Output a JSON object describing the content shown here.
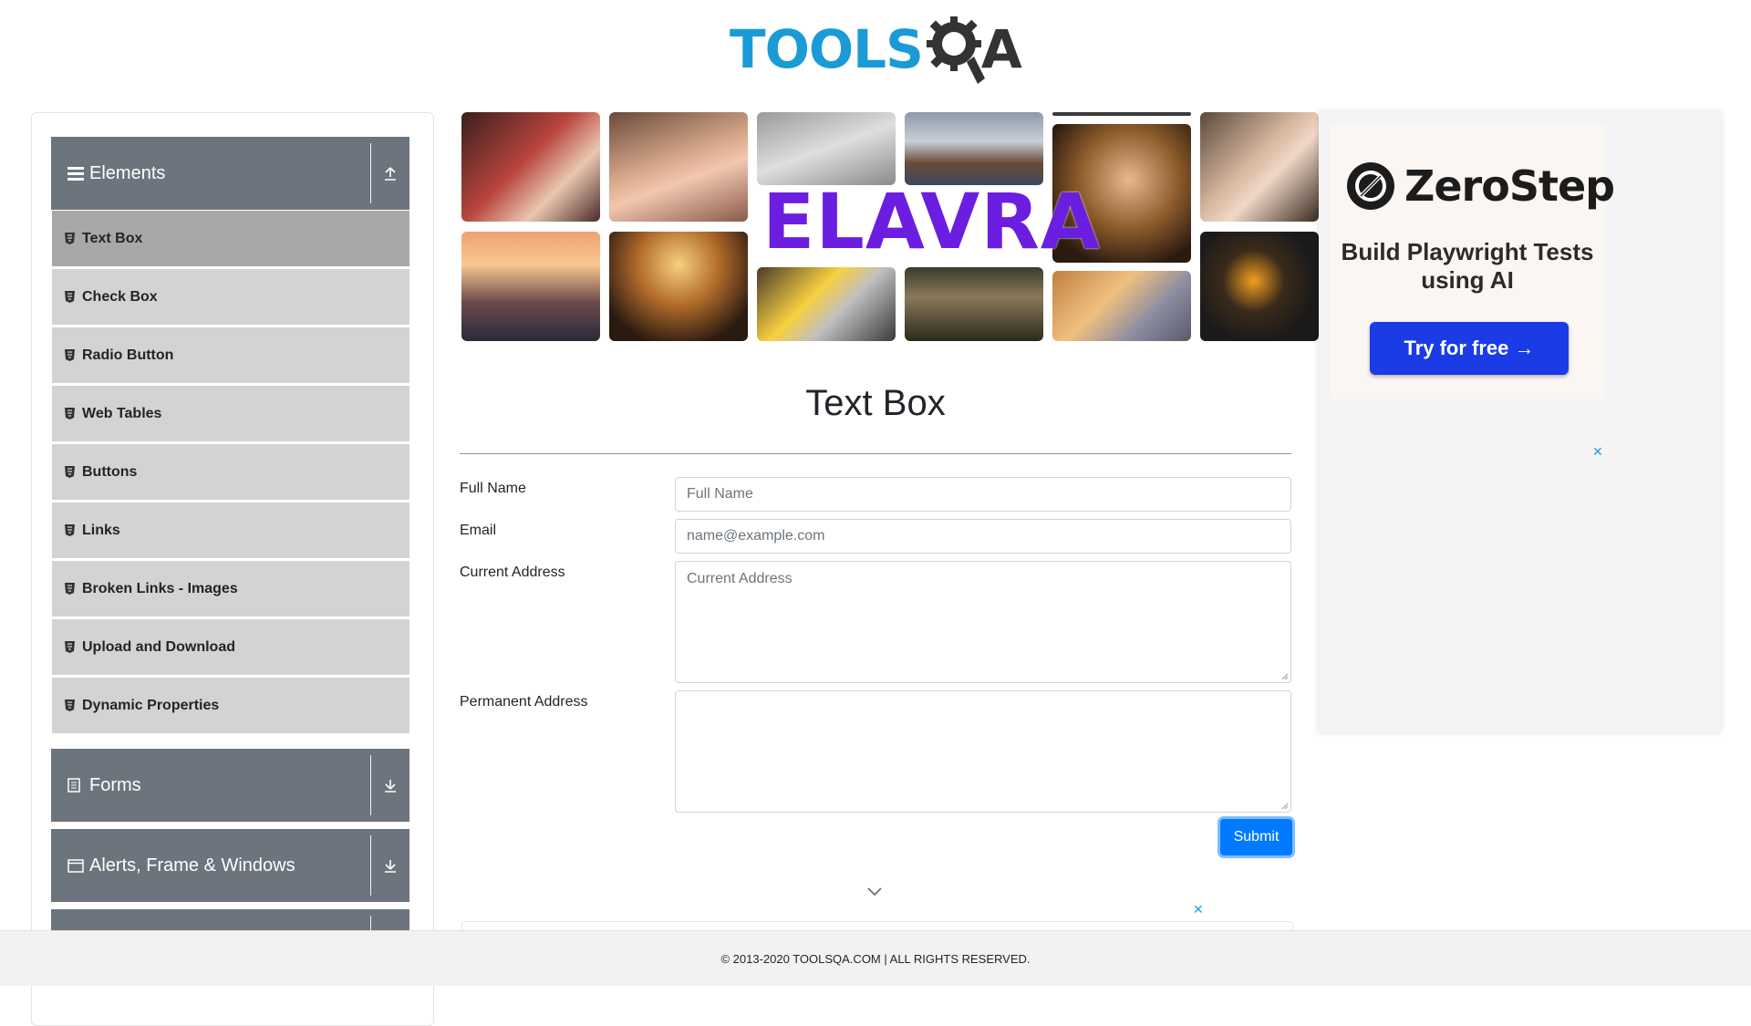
{
  "header": {
    "logo_tools": "TOOLS",
    "logo_q": "Q",
    "logo_a": "A"
  },
  "sidebar": {
    "groups": [
      {
        "label": "Elements",
        "icon": "hamburger-icon",
        "toggle": "collapse-up-icon"
      },
      {
        "label": "Forms",
        "icon": "document-icon",
        "toggle": "expand-down-icon"
      },
      {
        "label": "Alerts, Frame & Windows",
        "icon": "window-icon",
        "toggle": "expand-down-icon"
      }
    ],
    "items": [
      {
        "label": "Text Box",
        "active": true
      },
      {
        "label": "Check Box"
      },
      {
        "label": "Radio Button"
      },
      {
        "label": "Web Tables"
      },
      {
        "label": "Buttons"
      },
      {
        "label": "Links"
      },
      {
        "label": "Broken Links - Images"
      },
      {
        "label": "Upload and Download"
      },
      {
        "label": "Dynamic Properties"
      }
    ]
  },
  "banner": {
    "brand": "ELAVRA"
  },
  "main": {
    "title": "Text Box",
    "fields": {
      "full_name_label": "Full Name",
      "full_name_placeholder": "Full Name",
      "email_label": "Email",
      "email_placeholder": "name@example.com",
      "current_address_label": "Current Address",
      "current_address_placeholder": "Current Address",
      "permanent_address_label": "Permanent Address"
    },
    "submit_label": "Submit"
  },
  "ad": {
    "brand": "ZeroStep",
    "headline": "Build Playwright Tests using AI",
    "cta": "Try for free →",
    "close": "✕"
  },
  "bottom_ad": {
    "close": "✕"
  },
  "footer": {
    "text": "© 2013-2020 TOOLSQA.COM | ALL RIGHTS RESERVED."
  },
  "colors": {
    "group_bg": "#6c757d",
    "item_bg": "#d3d3d3",
    "item_active_bg": "#a8a8a8",
    "primary": "#007bff",
    "logo_blue": "#1a9bd6",
    "ad_cta": "#1b3be6",
    "banner_brand": "#6b1ee0"
  }
}
